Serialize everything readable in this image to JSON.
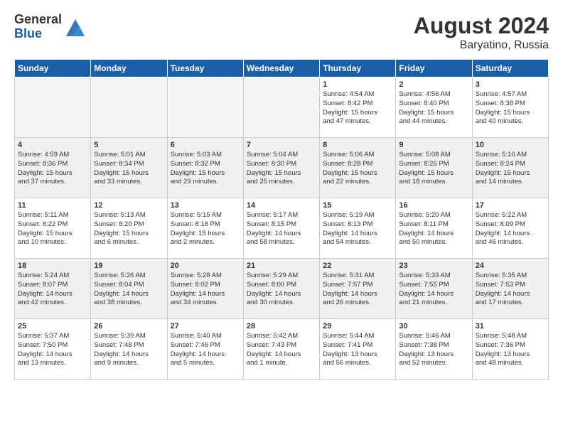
{
  "header": {
    "logo_general": "General",
    "logo_blue": "Blue",
    "month_year": "August 2024",
    "location": "Baryatino, Russia"
  },
  "days_of_week": [
    "Sunday",
    "Monday",
    "Tuesday",
    "Wednesday",
    "Thursday",
    "Friday",
    "Saturday"
  ],
  "weeks": [
    [
      {
        "num": "",
        "info": "",
        "empty": true
      },
      {
        "num": "",
        "info": "",
        "empty": true
      },
      {
        "num": "",
        "info": "",
        "empty": true
      },
      {
        "num": "",
        "info": "",
        "empty": true
      },
      {
        "num": "1",
        "info": "Sunrise: 4:54 AM\nSunset: 8:42 PM\nDaylight: 15 hours\nand 47 minutes.",
        "empty": false
      },
      {
        "num": "2",
        "info": "Sunrise: 4:56 AM\nSunset: 8:40 PM\nDaylight: 15 hours\nand 44 minutes.",
        "empty": false
      },
      {
        "num": "3",
        "info": "Sunrise: 4:57 AM\nSunset: 8:38 PM\nDaylight: 15 hours\nand 40 minutes.",
        "empty": false
      }
    ],
    [
      {
        "num": "4",
        "info": "Sunrise: 4:59 AM\nSunset: 8:36 PM\nDaylight: 15 hours\nand 37 minutes.",
        "empty": false
      },
      {
        "num": "5",
        "info": "Sunrise: 5:01 AM\nSunset: 8:34 PM\nDaylight: 15 hours\nand 33 minutes.",
        "empty": false
      },
      {
        "num": "6",
        "info": "Sunrise: 5:03 AM\nSunset: 8:32 PM\nDaylight: 15 hours\nand 29 minutes.",
        "empty": false
      },
      {
        "num": "7",
        "info": "Sunrise: 5:04 AM\nSunset: 8:30 PM\nDaylight: 15 hours\nand 25 minutes.",
        "empty": false
      },
      {
        "num": "8",
        "info": "Sunrise: 5:06 AM\nSunset: 8:28 PM\nDaylight: 15 hours\nand 22 minutes.",
        "empty": false
      },
      {
        "num": "9",
        "info": "Sunrise: 5:08 AM\nSunset: 8:26 PM\nDaylight: 15 hours\nand 18 minutes.",
        "empty": false
      },
      {
        "num": "10",
        "info": "Sunrise: 5:10 AM\nSunset: 8:24 PM\nDaylight: 15 hours\nand 14 minutes.",
        "empty": false
      }
    ],
    [
      {
        "num": "11",
        "info": "Sunrise: 5:11 AM\nSunset: 8:22 PM\nDaylight: 15 hours\nand 10 minutes.",
        "empty": false
      },
      {
        "num": "12",
        "info": "Sunrise: 5:13 AM\nSunset: 8:20 PM\nDaylight: 15 hours\nand 6 minutes.",
        "empty": false
      },
      {
        "num": "13",
        "info": "Sunrise: 5:15 AM\nSunset: 8:18 PM\nDaylight: 15 hours\nand 2 minutes.",
        "empty": false
      },
      {
        "num": "14",
        "info": "Sunrise: 5:17 AM\nSunset: 8:15 PM\nDaylight: 14 hours\nand 58 minutes.",
        "empty": false
      },
      {
        "num": "15",
        "info": "Sunrise: 5:19 AM\nSunset: 8:13 PM\nDaylight: 14 hours\nand 54 minutes.",
        "empty": false
      },
      {
        "num": "16",
        "info": "Sunrise: 5:20 AM\nSunset: 8:11 PM\nDaylight: 14 hours\nand 50 minutes.",
        "empty": false
      },
      {
        "num": "17",
        "info": "Sunrise: 5:22 AM\nSunset: 8:09 PM\nDaylight: 14 hours\nand 46 minutes.",
        "empty": false
      }
    ],
    [
      {
        "num": "18",
        "info": "Sunrise: 5:24 AM\nSunset: 8:07 PM\nDaylight: 14 hours\nand 42 minutes.",
        "empty": false
      },
      {
        "num": "19",
        "info": "Sunrise: 5:26 AM\nSunset: 8:04 PM\nDaylight: 14 hours\nand 38 minutes.",
        "empty": false
      },
      {
        "num": "20",
        "info": "Sunrise: 5:28 AM\nSunset: 8:02 PM\nDaylight: 14 hours\nand 34 minutes.",
        "empty": false
      },
      {
        "num": "21",
        "info": "Sunrise: 5:29 AM\nSunset: 8:00 PM\nDaylight: 14 hours\nand 30 minutes.",
        "empty": false
      },
      {
        "num": "22",
        "info": "Sunrise: 5:31 AM\nSunset: 7:57 PM\nDaylight: 14 hours\nand 26 minutes.",
        "empty": false
      },
      {
        "num": "23",
        "info": "Sunrise: 5:33 AM\nSunset: 7:55 PM\nDaylight: 14 hours\nand 21 minutes.",
        "empty": false
      },
      {
        "num": "24",
        "info": "Sunrise: 5:35 AM\nSunset: 7:53 PM\nDaylight: 14 hours\nand 17 minutes.",
        "empty": false
      }
    ],
    [
      {
        "num": "25",
        "info": "Sunrise: 5:37 AM\nSunset: 7:50 PM\nDaylight: 14 hours\nand 13 minutes.",
        "empty": false
      },
      {
        "num": "26",
        "info": "Sunrise: 5:39 AM\nSunset: 7:48 PM\nDaylight: 14 hours\nand 9 minutes.",
        "empty": false
      },
      {
        "num": "27",
        "info": "Sunrise: 5:40 AM\nSunset: 7:46 PM\nDaylight: 14 hours\nand 5 minutes.",
        "empty": false
      },
      {
        "num": "28",
        "info": "Sunrise: 5:42 AM\nSunset: 7:43 PM\nDaylight: 14 hours\nand 1 minute.",
        "empty": false
      },
      {
        "num": "29",
        "info": "Sunrise: 5:44 AM\nSunset: 7:41 PM\nDaylight: 13 hours\nand 56 minutes.",
        "empty": false
      },
      {
        "num": "30",
        "info": "Sunrise: 5:46 AM\nSunset: 7:38 PM\nDaylight: 13 hours\nand 52 minutes.",
        "empty": false
      },
      {
        "num": "31",
        "info": "Sunrise: 5:48 AM\nSunset: 7:36 PM\nDaylight: 13 hours\nand 48 minutes.",
        "empty": false
      }
    ]
  ]
}
